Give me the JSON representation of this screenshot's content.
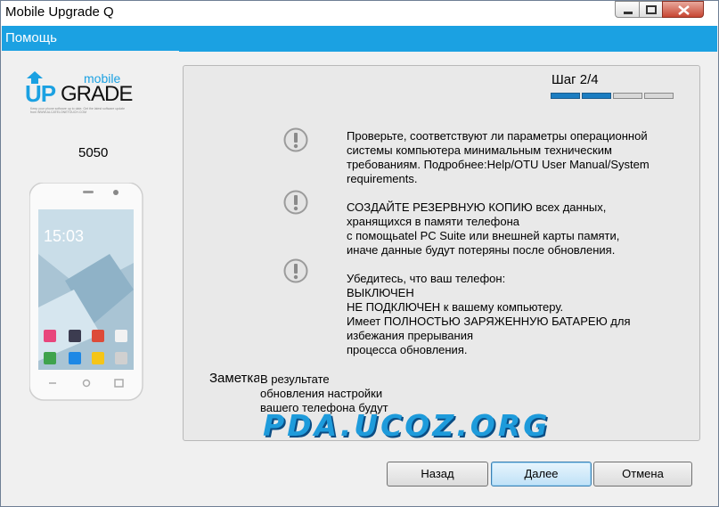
{
  "window": {
    "title": "Mobile Upgrade Q"
  },
  "header": {
    "title": "Помощь"
  },
  "sidebar": {
    "logo": {
      "top": "mobile",
      "up": "UP",
      "grade": "GRADE",
      "tagline": "Keep your phone software up to date. Get the latest software update from WWW.ALCATELONETOUCH.COM"
    },
    "model": "5050",
    "phone_screen": {
      "time": "15:03"
    }
  },
  "step": {
    "label": "Шаг 2/4",
    "current": 2,
    "total": 4
  },
  "requirements": [
    {
      "icon": "warning-icon",
      "text": "Проверьте, соответствуют ли параметры операционной\nсистемы компьютера минимальным техническим\nтребованиям. Подробнее:Help/OTU User Manual/System\nrequirements."
    },
    {
      "icon": "warning-icon",
      "text": "СОЗДАЙТЕ РЕЗЕРВНУЮ КОПИЮ всех данных,\nхранящихся в памяти телефона\nс помощьatel PC Suite или внешней карты памяти,\nиначе данные будут потеряны после обновления."
    },
    {
      "icon": "warning-icon",
      "text": "Убедитесь, что ваш телефон:\nВЫКЛЮЧЕН\nНЕ ПОДКЛЮЧЕН к вашему компьютеру.\nИмеет ПОЛНОСТЬЮ ЗАРЯЖЕННУЮ БАТАРЕЮ для\nизбежания прерывания\nпроцесса обновления."
    }
  ],
  "note": {
    "label": "Заметка",
    "text": "В результате\nобновления настройки\nвашего телефона будут"
  },
  "watermark": "PDA.UCOZ.ORG",
  "buttons": {
    "back": "Назад",
    "next": "Далее",
    "cancel": "Отмена"
  },
  "colors": {
    "accent": "#1ba1e2",
    "progress": "#1b7dc1"
  }
}
